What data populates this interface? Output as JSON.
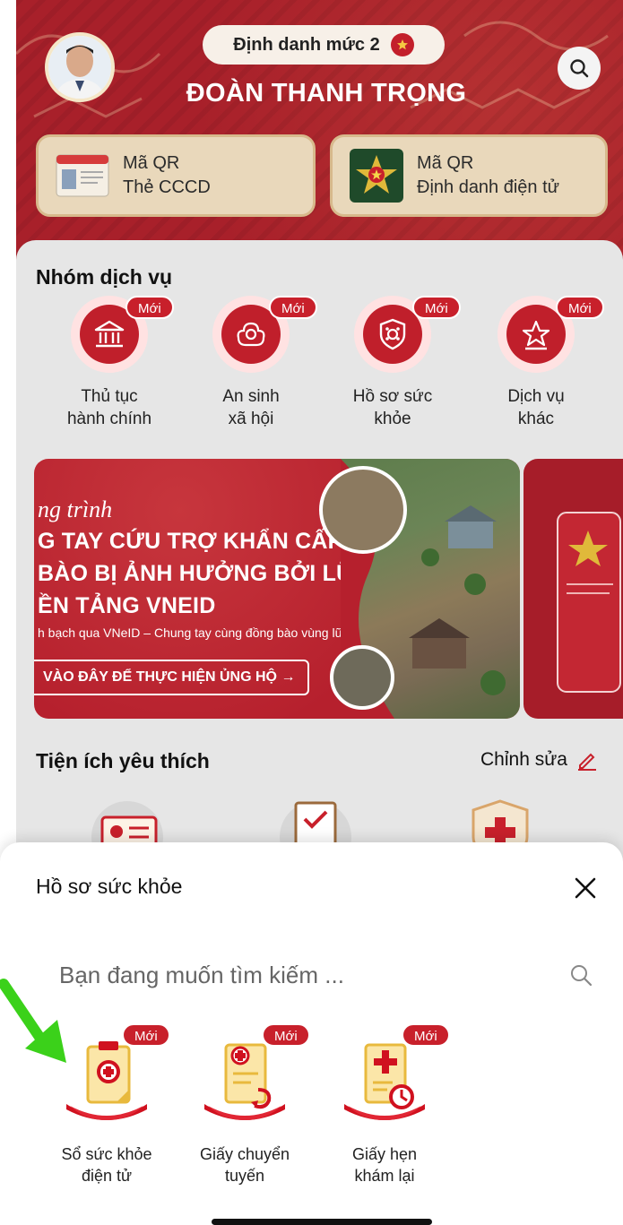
{
  "header": {
    "level_label": "Định danh mức 2",
    "user_name": "ĐOÀN THANH TRỌNG",
    "qr_cards": [
      {
        "line1": "Mã QR",
        "line2": "Thẻ CCCD"
      },
      {
        "line1": "Mã QR",
        "line2": "Định danh điện tử"
      }
    ]
  },
  "service_group": {
    "title": "Nhóm dịch vụ",
    "new_badge": "Mới",
    "items": [
      {
        "label": "Thủ tục\nhành chính",
        "icon": "government-building-icon"
      },
      {
        "label": "An sinh\nxã hội",
        "icon": "social-welfare-icon"
      },
      {
        "label": "Hồ sơ sức\nkhỏe",
        "icon": "health-shield-icon"
      },
      {
        "label": "Dịch vụ\nkhác",
        "icon": "other-services-icon"
      }
    ]
  },
  "banner": {
    "italic": "ng trình",
    "line1": "G TAY CỨU TRỢ KHẨN CẤP",
    "line2": "BÀO BỊ ẢNH HƯỞNG BỞI LŨ LỤT",
    "line3": "ỀN TẢNG VNEID",
    "small": "h bạch qua VNeID – Chung tay cùng đồng bào vùng lũ",
    "cta": "VÀO ĐÂY ĐỂ THỰC HIỆN ỦNG HỘ →"
  },
  "favorites": {
    "title": "Tiện ích yêu thích",
    "edit_label": "Chỉnh sửa"
  },
  "health_sheet": {
    "title": "Hồ sơ sức khỏe",
    "search_placeholder": "Bạn đang muốn tìm kiếm ...",
    "new_badge": "Mới",
    "items": [
      {
        "label": "Sổ sức khỏe\nđiện tử",
        "icon": "health-book-icon"
      },
      {
        "label": "Giấy chuyển\ntuyến",
        "icon": "referral-paper-icon"
      },
      {
        "label": "Giấy hẹn\nkhám lại",
        "icon": "re-exam-appointment-icon"
      }
    ]
  },
  "colors": {
    "brand_red": "#c01f2b",
    "header_red": "#a8202a",
    "card_beige": "#e9d8bb",
    "panel_gray": "#e6e6e6",
    "arrow_green": "#3bd11a"
  }
}
